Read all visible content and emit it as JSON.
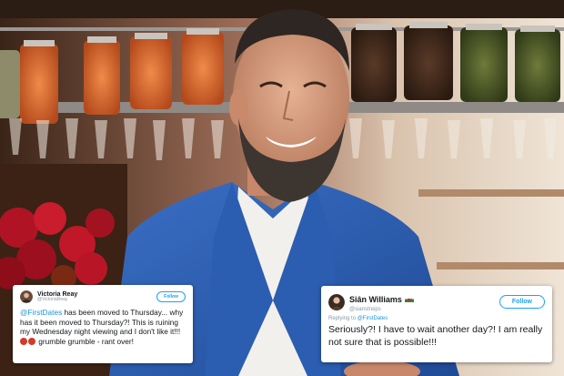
{
  "tweets": [
    {
      "display_name": "Victoria Reay",
      "handle": "@VictoriaReay",
      "follow_label": "Follow",
      "mention": "@FirstDates",
      "text": " has been moved to Thursday... why has it been moved to Thursday?! This is ruining my Wednesday night viewing and I don't like it!!! ",
      "text_after_emoji": " grumble grumble - rant over!"
    },
    {
      "display_name": "Siân Williams",
      "handle": "@sianstreips",
      "follow_label": "Follow",
      "reply_prefix": "Replying to ",
      "reply_to": "@FirstDates",
      "text": "Seriously?! I have to wait another day?! I am really not sure that is possible!!!"
    }
  ],
  "colors": {
    "twitter_blue": "#1da1f2",
    "emoji_red": "#d23a2c"
  },
  "icons": [
    "angry-face-emoji-icon",
    "welsh-flag-icon"
  ]
}
